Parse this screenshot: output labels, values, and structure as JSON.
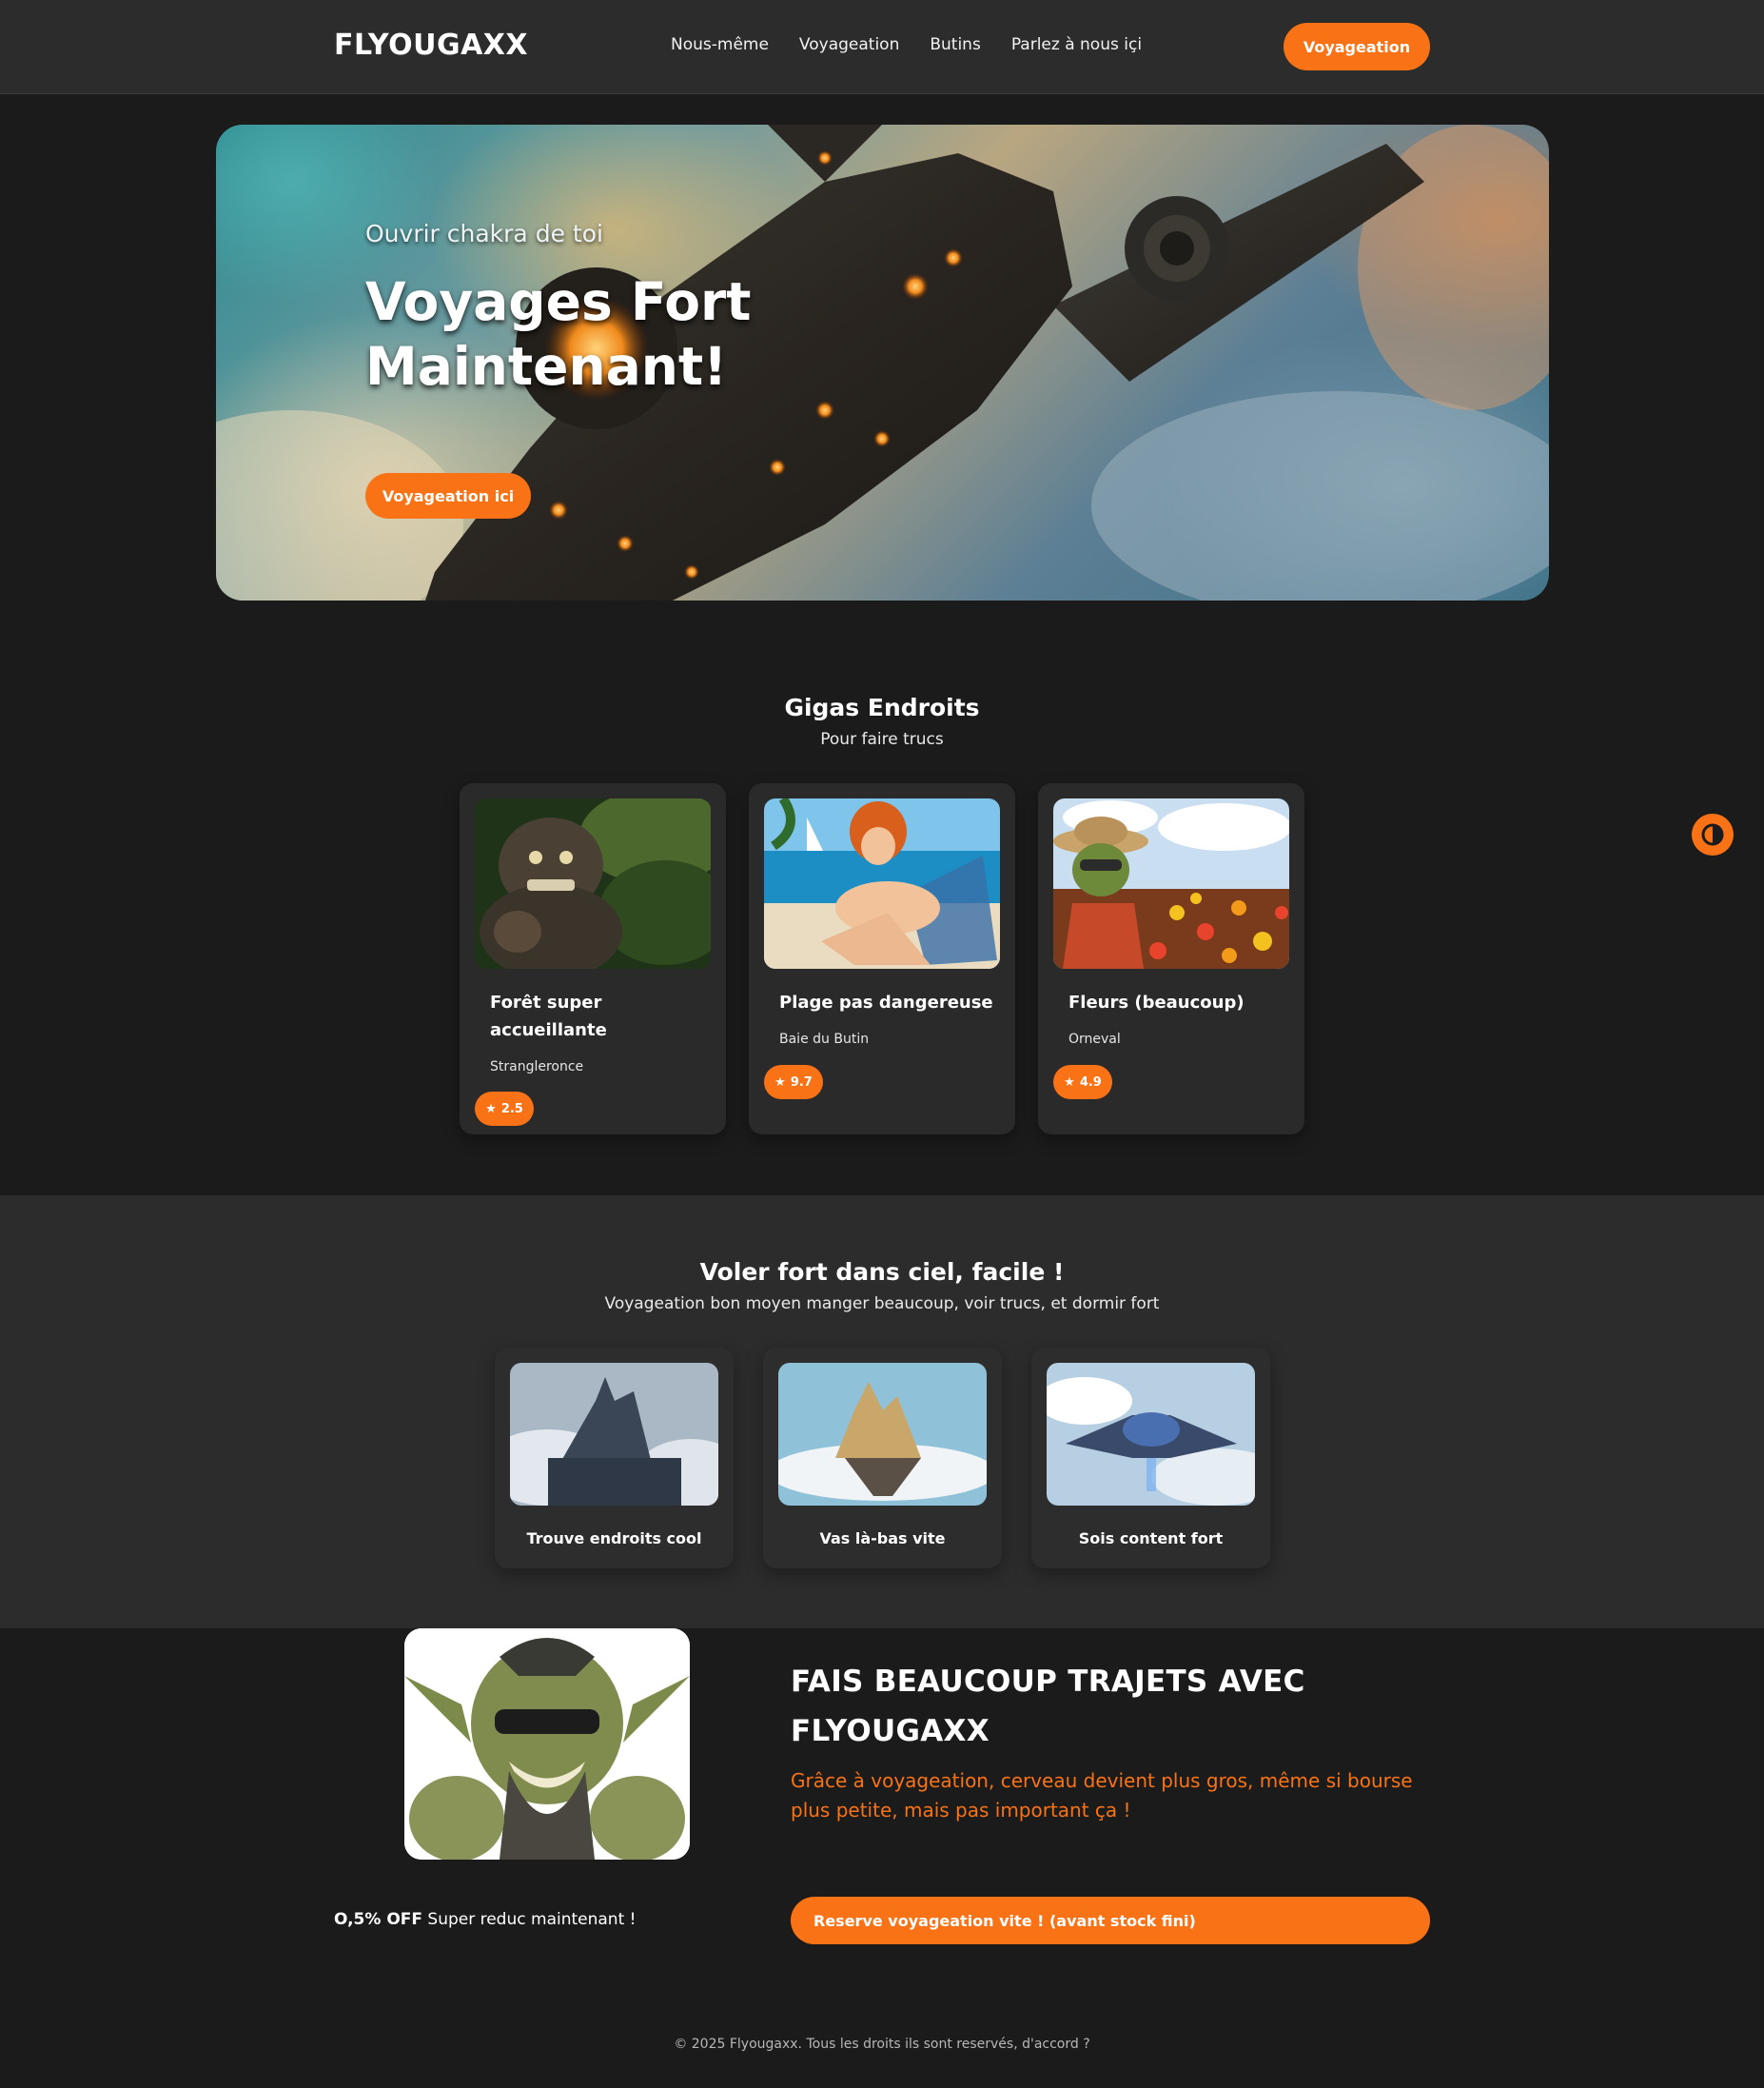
{
  "nav": {
    "brand": "FLYOUGAXX",
    "links": [
      "Nous-même",
      "Voyageation",
      "Butins",
      "Parlez à nous içi"
    ],
    "cta": "Voyageation"
  },
  "hero": {
    "subtitle": "Ouvrir chakra de toi",
    "title": "Voyages Fort Maintenant!",
    "cta": "Voyageation ici"
  },
  "places": {
    "title": "Gigas Endroits",
    "subtitle": "Pour faire trucs",
    "items": [
      {
        "name": "Forêt super accueillante",
        "location": "Strangleronce",
        "rating": "2.5"
      },
      {
        "name": "Plage pas dangereuse",
        "location": "Baie du Butin",
        "rating": "9.7"
      },
      {
        "name": "Fleurs (beaucoup)",
        "location": "Orneval",
        "rating": "4.9"
      }
    ],
    "rating_icon": "★"
  },
  "fly": {
    "title": "Voler fort dans ciel, facile !",
    "subtitle": "Voyageation bon moyen manger beaucoup, voir trucs, et dormir fort",
    "features": [
      {
        "label": "Trouve endroits cool"
      },
      {
        "label": "Vas là-bas vite"
      },
      {
        "label": "Sois content fort"
      }
    ]
  },
  "promo": {
    "title": "FAIS BEAUCOUP TRAJETS AVEC FLYOUGAXX",
    "text": "Grâce à voyageation, cerveau devient plus gros, même si bourse plus petite, mais pas important ça !",
    "discount_bold": "O,5% OFF",
    "discount_text": " Super reduc maintenant !",
    "cta": "Reserve voyageation vite ! (avant stock fini)"
  },
  "footer": {
    "text": "© 2025 Flyougaxx. Tous les droits ils sont reservés, d'accord ?"
  },
  "colors": {
    "accent": "#f97316",
    "background": "#1b1b1b",
    "surface": "#2c2c2c"
  }
}
